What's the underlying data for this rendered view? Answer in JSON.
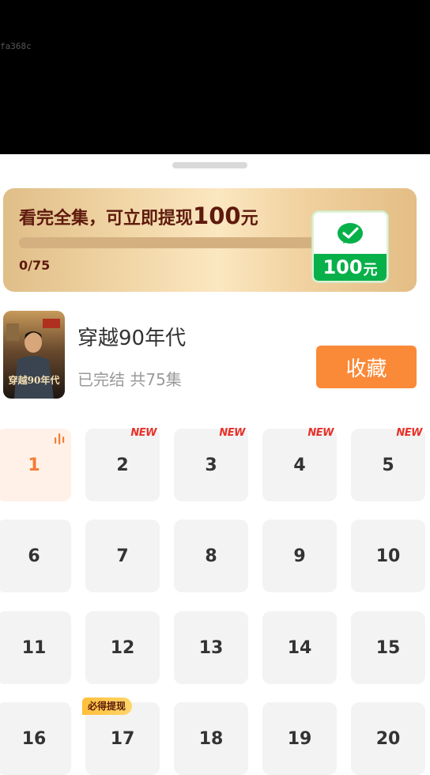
{
  "debug": {
    "text": "fa368c"
  },
  "reward": {
    "title_prefix": "看完全集，可立即提现",
    "amount": "100",
    "unit": "元",
    "progress_text": "0/75",
    "progress_fraction": 0,
    "wechat_amount": "100",
    "wechat_unit": "元"
  },
  "show": {
    "title": "穿越90年代",
    "meta": "已完结 共75集",
    "poster_text": "穿越90年代",
    "favorite_label": "收藏"
  },
  "colors": {
    "accent": "#fa8938",
    "new_tag": "#e8322a",
    "wechat_green": "#08b04a"
  },
  "episodes": [
    {
      "number": "1",
      "current": true,
      "icon": "playing-bars-icon"
    },
    {
      "number": "2",
      "badge": "NEW"
    },
    {
      "number": "3",
      "badge": "NEW"
    },
    {
      "number": "4",
      "badge": "NEW"
    },
    {
      "number": "5",
      "badge": "NEW"
    },
    {
      "number": "6"
    },
    {
      "number": "7"
    },
    {
      "number": "8"
    },
    {
      "number": "9"
    },
    {
      "number": "10"
    },
    {
      "number": "11"
    },
    {
      "number": "12"
    },
    {
      "number": "13"
    },
    {
      "number": "14"
    },
    {
      "number": "15"
    },
    {
      "number": "16"
    },
    {
      "number": "17",
      "tag": "必得提现"
    },
    {
      "number": "18"
    },
    {
      "number": "19"
    },
    {
      "number": "20"
    }
  ]
}
